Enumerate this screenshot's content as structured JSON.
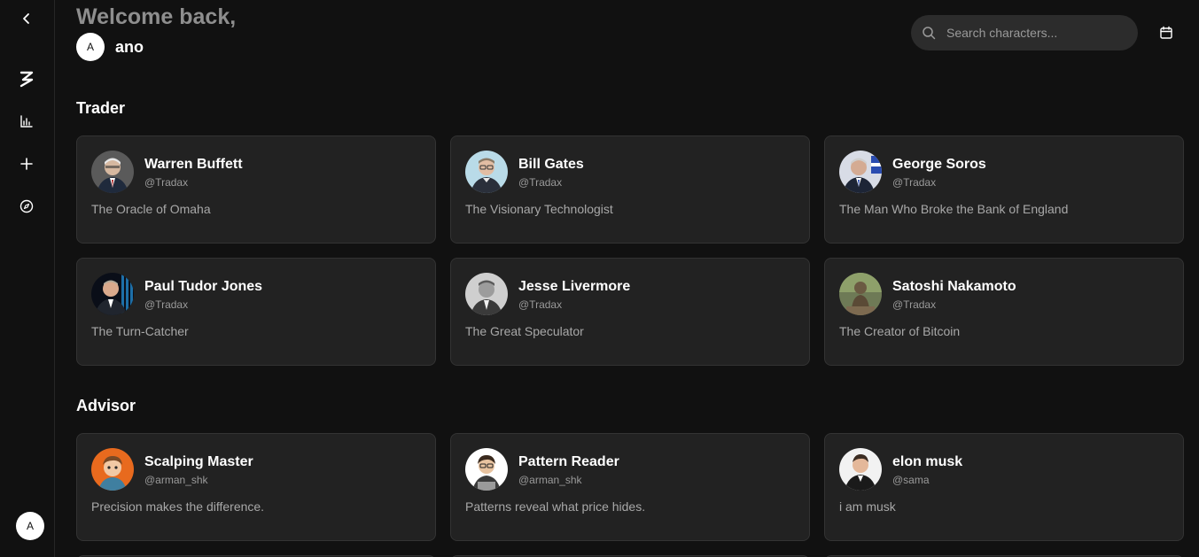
{
  "sidebar": {
    "items": [
      {
        "name": "collapse-button",
        "icon": "chevron-left-icon"
      },
      {
        "name": "logo-button",
        "icon": "brand-z-icon"
      },
      {
        "name": "chart-button",
        "icon": "bar-chart-icon"
      },
      {
        "name": "create-button",
        "icon": "plus-icon"
      },
      {
        "name": "explore-button",
        "icon": "compass-icon"
      }
    ],
    "avatar_initial": "A"
  },
  "header": {
    "welcome": "Welcome back,",
    "user_initial": "A",
    "user_name": "ano"
  },
  "search": {
    "placeholder": "Search characters...",
    "icon": "search-icon"
  },
  "calendar_icon": "calendar-icon",
  "sections": [
    {
      "title": "Trader",
      "cards": [
        {
          "name": "Warren Buffett",
          "handle": "@Tradax",
          "desc": "The Oracle of Omaha"
        },
        {
          "name": "Bill Gates",
          "handle": "@Tradax",
          "desc": "The Visionary Technologist"
        },
        {
          "name": "George Soros",
          "handle": "@Tradax",
          "desc": "The Man Who Broke the Bank of England"
        },
        {
          "name": "Paul Tudor Jones",
          "handle": "@Tradax",
          "desc": "The Turn-Catcher"
        },
        {
          "name": "Jesse Livermore",
          "handle": "@Tradax",
          "desc": "The Great Speculator"
        },
        {
          "name": "Satoshi Nakamoto",
          "handle": "@Tradax",
          "desc": "The Creator of Bitcoin"
        }
      ]
    },
    {
      "title": "Advisor",
      "cards": [
        {
          "name": "Scalping Master",
          "handle": "@arman_shk",
          "desc": "Precision makes the difference."
        },
        {
          "name": "Pattern Reader",
          "handle": "@arman_shk",
          "desc": "Patterns reveal what price hides."
        },
        {
          "name": "elon musk",
          "handle": "@sama",
          "desc": "i am musk"
        }
      ]
    }
  ],
  "colors": {
    "background": "#111111",
    "card": "#222222",
    "card_border": "#333333",
    "muted_text": "#9a9a9a",
    "welcome_text": "#8e8e8e"
  }
}
